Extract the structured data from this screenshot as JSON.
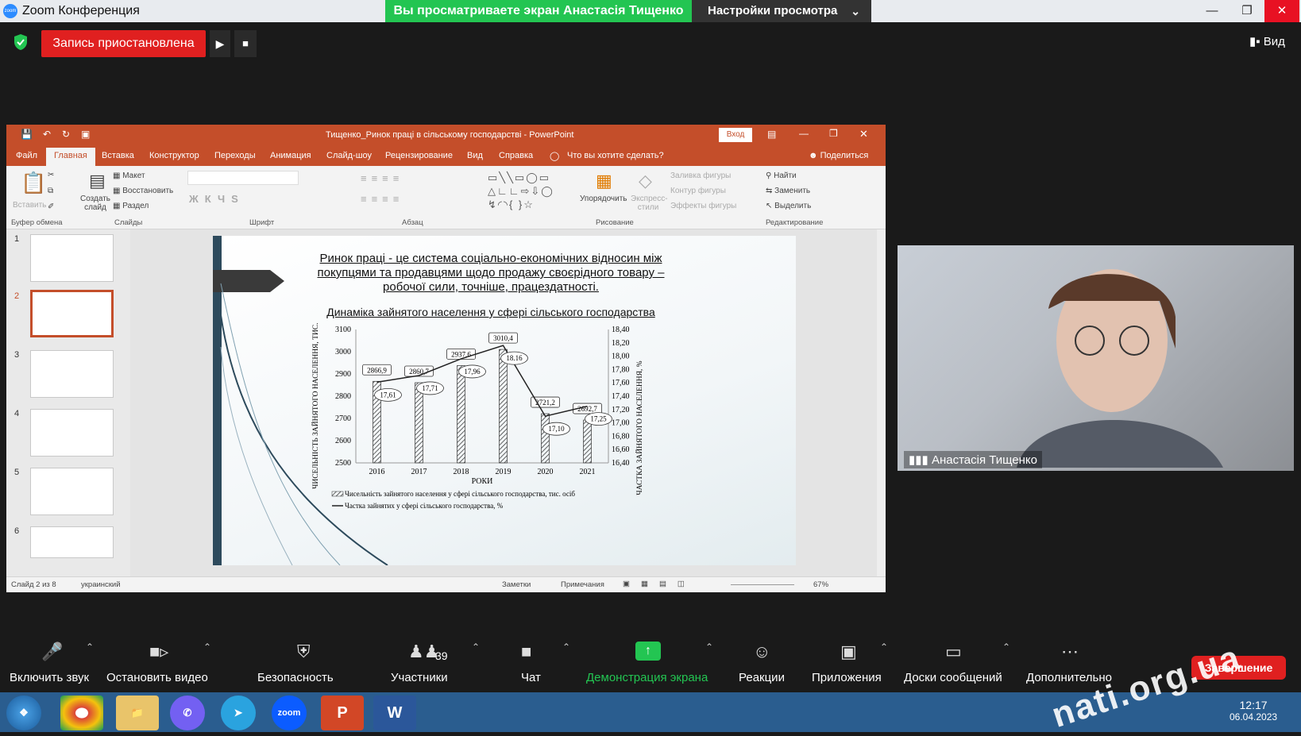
{
  "zoom": {
    "app_title": "Zoom Конференция",
    "share_banner": "Вы просматриваете экран Анастасія Тищенко",
    "view_settings": "Настройки просмотра",
    "recording_status": "Запись приостановлена",
    "view_button": "Вид",
    "participant_name": "Анастасія Тищенко",
    "participant_count": "39",
    "end_button": "Завершение",
    "toolbar": [
      {
        "label": "Включить звук",
        "icon": "mic-muted-icon"
      },
      {
        "label": "Остановить видео",
        "icon": "video-camera-icon"
      },
      {
        "label": "Безопасность",
        "icon": "shield-icon"
      },
      {
        "label": "Участники",
        "icon": "participants-icon"
      },
      {
        "label": "Чат",
        "icon": "chat-icon"
      },
      {
        "label": "Демонстрация экрана",
        "icon": "share-screen-icon"
      },
      {
        "label": "Реакции",
        "icon": "reactions-icon"
      },
      {
        "label": "Приложения",
        "icon": "apps-icon"
      },
      {
        "label": "Доски сообщений",
        "icon": "whiteboard-icon"
      },
      {
        "label": "Дополнительно",
        "icon": "more-icon"
      }
    ]
  },
  "ppt": {
    "title": "Тищенко_Ринок праці в сільському господарстві - PowerPoint",
    "login": "Вход",
    "share": "Поделиться",
    "tabs": [
      "Файл",
      "Главная",
      "Вставка",
      "Конструктор",
      "Переходы",
      "Анимация",
      "Слайд-шоу",
      "Рецензирование",
      "Вид",
      "Справка"
    ],
    "tell_me": "Что вы хотите сделать?",
    "ribbon": {
      "paste": "Вставить",
      "clipboard": "Буфер обмена",
      "create_slide": "Создать слайд",
      "layout": "Макет",
      "reset": "Восстановить",
      "section": "Раздел",
      "slides": "Слайды",
      "font": "Шрифт",
      "paragraph": "Абзац",
      "arrange": "Упорядочить",
      "express": "Экспресс-стили",
      "shape_fill": "Заливка фигуры",
      "shape_outline": "Контур фигуры",
      "shape_effects": "Эффекты фигуры",
      "drawing": "Рисование",
      "find": "Найти",
      "replace": "Заменить",
      "select": "Выделить",
      "editing": "Редактирование"
    },
    "slide_numbers": [
      "1",
      "2",
      "3",
      "4",
      "5",
      "6"
    ],
    "status": {
      "slide": "Слайд 2 из 8",
      "lang": "украинский",
      "notes": "Заметки",
      "comments": "Примечания",
      "zoom": "67%"
    }
  },
  "slide": {
    "heading_line1": "Ринок праці - це система соціально-економічних відносин між",
    "heading_line2": "покупцями та продавцями щодо продажу своєрідного товару –",
    "heading_line3": "робочої сили, точніше, працездатності.",
    "chart_title": "Динаміка зайнятого населення у сфері сільського господарства"
  },
  "chart_data": {
    "type": "bar",
    "categories": [
      "2016",
      "2017",
      "2018",
      "2019",
      "2020",
      "2021"
    ],
    "series": [
      {
        "name": "Чисельність зайнятого населення у сфері сільського господарства, тис. осіб",
        "values": [
          2866.9,
          2860.7,
          2937.6,
          3010.4,
          2721.2,
          2692.7
        ]
      },
      {
        "name": "Частка зайнятих у сфері сільського господарства, %",
        "values": [
          17.61,
          17.71,
          17.96,
          18.16,
          17.1,
          17.25
        ]
      }
    ],
    "bar_labels": [
      "2866,9",
      "2860,7",
      "2937,6",
      "3010,4",
      "2721,2",
      "2692,7"
    ],
    "line_labels": [
      "17,61",
      "17,71",
      "17,96",
      "18.16",
      "17,10",
      "17,25"
    ],
    "ylim": [
      2500,
      3100
    ],
    "y2lim": [
      16.4,
      18.4
    ],
    "y_ticks": [
      "3100",
      "3000",
      "2900",
      "2800",
      "2700",
      "2600",
      "2500"
    ],
    "y2_ticks": [
      "18,40",
      "18,20",
      "18,00",
      "17,80",
      "17,60",
      "17,40",
      "17,20",
      "17,00",
      "16,80",
      "16,60",
      "16,40"
    ],
    "xlabel": "РОКИ",
    "ylabel": "ЧИСЕЛЬНІСТЬ ЗАЙНЯТОГО НАСЕЛЕННЯ, ТИС. ОСІБ",
    "y2label": "ЧАСТКА ЗАЙНЯТОГО НАСЕЛЕННЯ, %"
  },
  "taskbar": {
    "time": "12:17",
    "date": "06.04.2023",
    "watermark": "nati.org.ua"
  }
}
